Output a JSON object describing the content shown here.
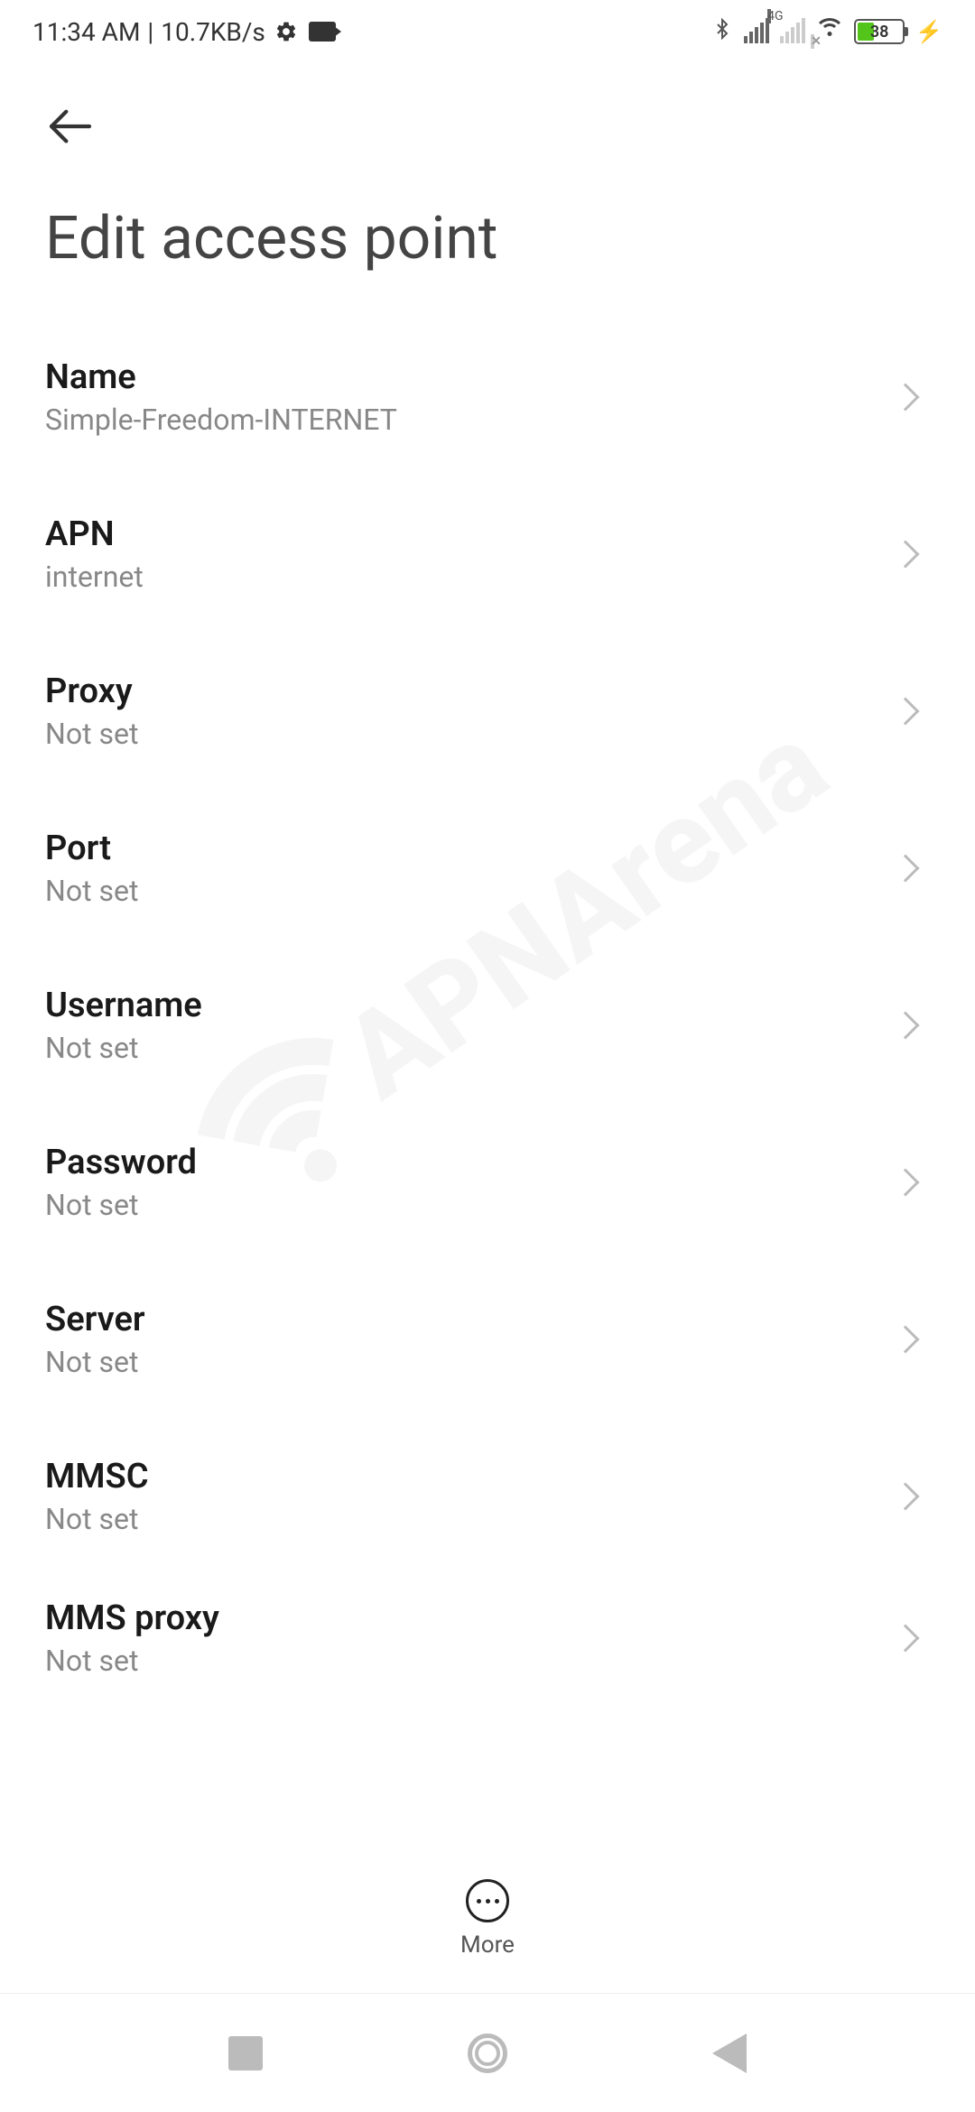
{
  "status": {
    "time": "11:34 AM",
    "sep": "|",
    "kbs": "10.7KB/s",
    "battery": "38"
  },
  "header": {
    "title": "Edit access point"
  },
  "rows": [
    {
      "label": "Name",
      "value": "Simple-Freedom-INTERNET"
    },
    {
      "label": "APN",
      "value": "internet"
    },
    {
      "label": "Proxy",
      "value": "Not set"
    },
    {
      "label": "Port",
      "value": "Not set"
    },
    {
      "label": "Username",
      "value": "Not set"
    },
    {
      "label": "Password",
      "value": "Not set"
    },
    {
      "label": "Server",
      "value": "Not set"
    },
    {
      "label": "MMSC",
      "value": "Not set"
    },
    {
      "label": "MMS proxy",
      "value": "Not set"
    }
  ],
  "bottom": {
    "more": "More"
  },
  "watermark": "APNArena"
}
